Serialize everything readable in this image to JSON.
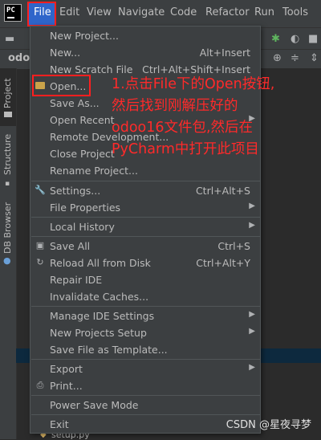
{
  "app_logo": "PC",
  "menubar": {
    "items": [
      "File",
      "Edit",
      "View",
      "Navigate",
      "Code",
      "Refactor",
      "Run",
      "Tools"
    ],
    "active": "File"
  },
  "navbar": {
    "project_crumb": "odoo"
  },
  "sidebar": {
    "tabs": [
      "Project",
      "Structure",
      "DB Browser"
    ]
  },
  "file_menu": {
    "items": [
      {
        "label": "New Project...",
        "shortcut": "",
        "submenu": false,
        "icon": ""
      },
      {
        "label": "New...",
        "shortcut": "Alt+Insert",
        "submenu": false,
        "icon": ""
      },
      {
        "label": "New Scratch File",
        "shortcut": "Ctrl+Alt+Shift+Insert",
        "submenu": false,
        "icon": ""
      },
      {
        "label": "Open...",
        "shortcut": "",
        "submenu": false,
        "icon": "folder-icon"
      },
      {
        "label": "Save As...",
        "shortcut": "",
        "submenu": false,
        "icon": ""
      },
      {
        "label": "Open Recent",
        "shortcut": "",
        "submenu": true,
        "icon": ""
      },
      {
        "label": "Remote Development...",
        "shortcut": "",
        "submenu": false,
        "icon": ""
      },
      {
        "label": "Close Project",
        "shortcut": "",
        "submenu": false,
        "icon": ""
      },
      {
        "label": "Rename Project...",
        "shortcut": "",
        "submenu": false,
        "icon": ""
      },
      {
        "label": "Settings...",
        "shortcut": "Ctrl+Alt+S",
        "submenu": false,
        "icon": "wrench-icon"
      },
      {
        "label": "File Properties",
        "shortcut": "",
        "submenu": true,
        "icon": ""
      },
      {
        "label": "Local History",
        "shortcut": "",
        "submenu": true,
        "icon": ""
      },
      {
        "label": "Save All",
        "shortcut": "Ctrl+S",
        "submenu": false,
        "icon": "save-icon"
      },
      {
        "label": "Reload All from Disk",
        "shortcut": "Ctrl+Alt+Y",
        "submenu": false,
        "icon": "reload-icon"
      },
      {
        "label": "Repair IDE",
        "shortcut": "",
        "submenu": false,
        "icon": ""
      },
      {
        "label": "Invalidate Caches...",
        "shortcut": "",
        "submenu": false,
        "icon": ""
      },
      {
        "label": "Manage IDE Settings",
        "shortcut": "",
        "submenu": true,
        "icon": ""
      },
      {
        "label": "New Projects Setup",
        "shortcut": "",
        "submenu": true,
        "icon": ""
      },
      {
        "label": "Save File as Template...",
        "shortcut": "",
        "submenu": false,
        "icon": ""
      },
      {
        "label": "Export",
        "shortcut": "",
        "submenu": true,
        "icon": ""
      },
      {
        "label": "Print...",
        "shortcut": "",
        "submenu": false,
        "icon": "print-icon"
      },
      {
        "label": "Power Save Mode",
        "shortcut": "",
        "submenu": false,
        "icon": ""
      },
      {
        "label": "Exit",
        "shortcut": "",
        "submenu": false,
        "icon": ""
      }
    ]
  },
  "annotation": {
    "lines": [
      "1.点击File下的Open按钮,",
      "然后找到刚解压好的",
      "odoo16文件包,然后在",
      "PyCharm中打开此项目"
    ],
    "color": "#ff2a2a"
  },
  "bottom_file": "setup.py",
  "watermark": "CSDN @星夜寻梦"
}
